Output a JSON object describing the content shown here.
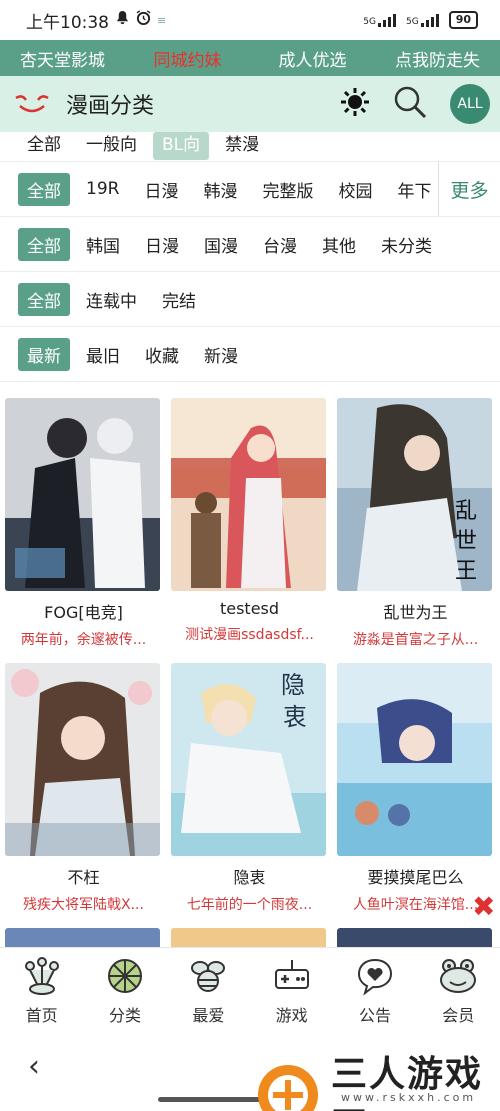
{
  "status_bar": {
    "time": "上午10:38",
    "network_1": "5G",
    "network_2": "5G",
    "battery": "90"
  },
  "top_nav": [
    {
      "label": "杏天堂影城",
      "active": false
    },
    {
      "label": "同城约妹",
      "active": true
    },
    {
      "label": "成人优选",
      "active": false
    },
    {
      "label": "点我防走失",
      "active": false
    }
  ],
  "header": {
    "title": "漫画分类",
    "all_label": "ALL"
  },
  "filters": {
    "row0": [
      "全部",
      "一般向",
      "BL向",
      "禁漫"
    ],
    "row1": [
      "全部",
      "19R",
      "日漫",
      "韩漫",
      "完整版",
      "校园",
      "年下"
    ],
    "row1_more": "更多",
    "row2": [
      "全部",
      "韩国",
      "日漫",
      "国漫",
      "台漫",
      "其他",
      "未分类"
    ],
    "row3": [
      "全部",
      "连载中",
      "完结"
    ],
    "row4": [
      "最新",
      "最旧",
      "收藏",
      "新漫"
    ]
  },
  "comics": [
    {
      "title": "FOG[电竞]",
      "desc": "两年前，余邃被传..."
    },
    {
      "title": "testesd",
      "desc": "测试漫画ssdasdsf..."
    },
    {
      "title": "乱世为王",
      "desc": "游淼是首富之子从..."
    },
    {
      "title": "不枉",
      "desc": "残疾大将军陆戟X..."
    },
    {
      "title": "隐衷",
      "desc": "七年前的一个雨夜..."
    },
    {
      "title": "要摸摸尾巴么",
      "desc": "人鱼叶溟在海洋馆..."
    }
  ],
  "tabs": [
    {
      "label": "首页",
      "icon": "frog-hand-icon"
    },
    {
      "label": "分类",
      "icon": "category-icon"
    },
    {
      "label": "最爱",
      "icon": "bee-icon"
    },
    {
      "label": "游戏",
      "icon": "gamepad-icon"
    },
    {
      "label": "公告",
      "icon": "chat-heart-icon"
    },
    {
      "label": "会员",
      "icon": "frog-face-icon"
    }
  ],
  "watermark": {
    "text": "三人游戏网",
    "url": "www.rskxxh.com"
  },
  "colors": {
    "accent": "#5aa088",
    "header_bg": "#d9f0e6",
    "highlight": "#e8312e",
    "desc": "#d23a3a"
  }
}
